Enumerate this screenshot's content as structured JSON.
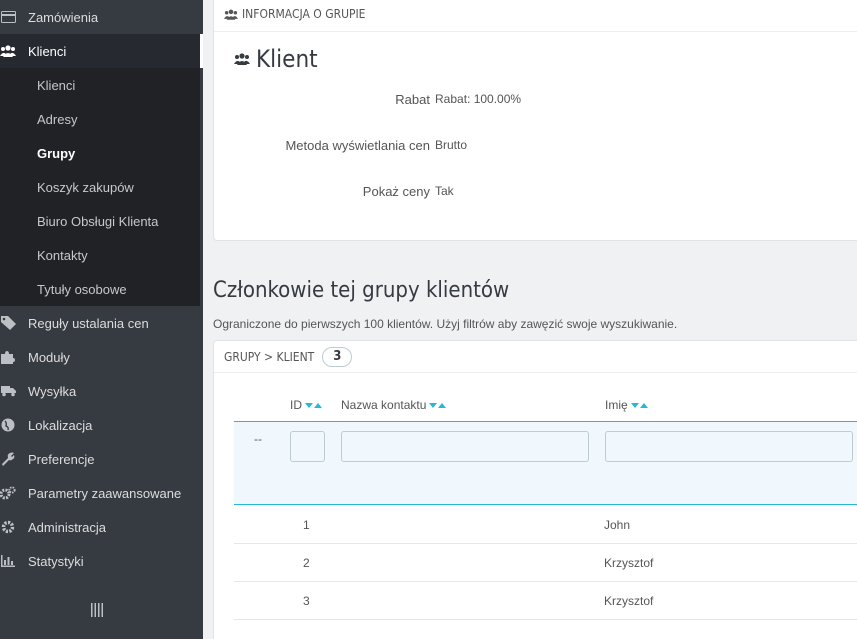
{
  "sidebar": {
    "items": [
      {
        "label": "Zamówienia",
        "icon": "credit-card-icon",
        "top": 0
      },
      {
        "label": "Klienci",
        "icon": "users-icon",
        "active": true
      },
      {
        "label": "Reguły ustalania cen",
        "icon": "tag-icon"
      },
      {
        "label": "Moduły",
        "icon": "puzzle-icon"
      },
      {
        "label": "Wysyłka",
        "icon": "truck-icon"
      },
      {
        "label": "Lokalizacja",
        "icon": "globe-icon"
      },
      {
        "label": "Preferencje",
        "icon": "wrench-icon"
      },
      {
        "label": "Parametry zaawansowane",
        "icon": "cogs-icon"
      },
      {
        "label": "Administracja",
        "icon": "gear-icon"
      },
      {
        "label": "Statystyki",
        "icon": "bar-chart-icon"
      }
    ],
    "submenu": [
      {
        "label": "Klienci"
      },
      {
        "label": "Adresy"
      },
      {
        "label": "Grupy",
        "current": true
      },
      {
        "label": "Koszyk zakupów"
      },
      {
        "label": "Biuro Obsługi Klienta"
      },
      {
        "label": "Kontakty"
      },
      {
        "label": "Tytuły osobowe"
      }
    ]
  },
  "group_panel": {
    "heading": "INFORMACJA O GRUPIE",
    "title": "Klient",
    "rows": [
      {
        "label": "Rabat",
        "value": "Rabat: 100.00%"
      },
      {
        "label": "Metoda wyświetlania cen",
        "value": "Brutto"
      },
      {
        "label": "Pokaż ceny",
        "value": "Tak"
      }
    ]
  },
  "members": {
    "title": "Członkowie tej grupy klientów",
    "subtitle": "Ograniczone do pierwszych 100 klientów. Użyj filtrów aby zawęzić swoje wyszukiwanie.",
    "panel_heading": "GRUPY > KLIENT",
    "count": "3",
    "columns": {
      "id": "ID",
      "contact": "Nazwa kontaktu",
      "first_name": "Imię"
    },
    "filter_dash": "--",
    "rows": [
      {
        "id": "1",
        "first_name": "John"
      },
      {
        "id": "2",
        "first_name": "Krzysztof"
      },
      {
        "id": "3",
        "first_name": "Krzysztof"
      }
    ]
  },
  "colors": {
    "sidebar": "#363a41",
    "accent": "#25b9d7"
  }
}
